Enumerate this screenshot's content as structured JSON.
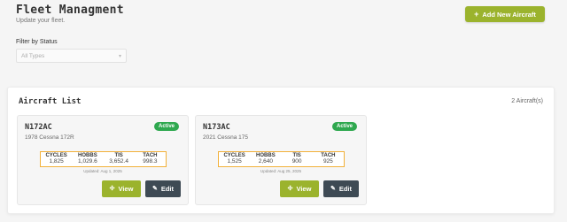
{
  "header": {
    "title": "Fleet Managment",
    "subtitle": "Update your fleet.",
    "add_button": "Add New Aircraft"
  },
  "filter": {
    "label": "Filter by Status",
    "selected": "All Types"
  },
  "aircraft_list": {
    "title": "Aircraft List",
    "count": "2 Aircraft(s)",
    "stat_headers": [
      "CYCLES",
      "HOBBS",
      "TIS",
      "TACH"
    ],
    "view_label": "View",
    "edit_label": "Edit",
    "cards": [
      {
        "tail": "N172AC",
        "model": "1978 Cessna 172R",
        "status": "Active",
        "stats": [
          "1,825",
          "1,029.6",
          "3,652.4",
          "998.3"
        ],
        "updated": "Updated: Aug 1, 2025"
      },
      {
        "tail": "N173AC",
        "model": "2021 Cessna 175",
        "status": "Active",
        "stats": [
          "1,525",
          "2,640",
          "900",
          "925"
        ],
        "updated": "Updated: Aug 25, 2025"
      }
    ]
  },
  "colors": {
    "accent": "#9bb32d",
    "active_badge": "#2fa84f",
    "edit_button": "#3e4a54",
    "stats_border": "#f2b13a"
  },
  "icons": {
    "add": "plus-icon",
    "view": "plane-icon",
    "edit": "pencil-icon",
    "filter": "chevron-down-icon"
  }
}
